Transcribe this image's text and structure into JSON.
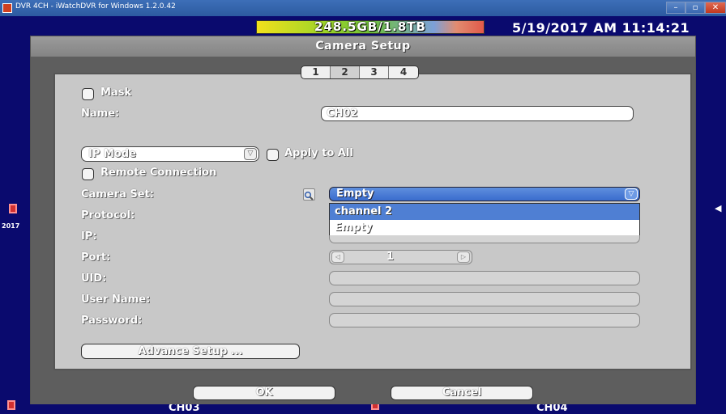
{
  "window": {
    "title": "DVR 4CH - iWatchDVR for Windows 1.2.0.42",
    "min": "–",
    "max": "▫",
    "close": "✕"
  },
  "status": {
    "storage": "248.5GB/1.8TB",
    "datetime": "5/19/2017 AM 11:14:21"
  },
  "background": {
    "cam_labels": [
      "CH03",
      "CH04"
    ],
    "side_year": "2017",
    "arrow": "◀"
  },
  "dialog": {
    "title": "Camera Setup",
    "tabs": [
      "1",
      "2",
      "3",
      "4"
    ],
    "active_tab": "2",
    "mask_label": "Mask",
    "name_label": "Name:",
    "name_value": "CH02",
    "mode_value": "IP Mode",
    "mode_arrow": "▽",
    "apply_all_label": "Apply to All",
    "remote_label": "Remote Connection",
    "camera_set_label": "Camera Set:",
    "camera_set_value": "Empty",
    "camera_set_arrow": "▽",
    "camera_set_options": [
      "channel 2",
      "Empty"
    ],
    "protocol_label": "Protocol:",
    "ip_label": "IP:",
    "port_label": "Port:",
    "port_value": "1",
    "port_dec": "◁",
    "port_inc": "▷",
    "uid_label": "UID:",
    "username_label": "User Name:",
    "password_label": "Password:",
    "advance_button": "Advance Setup ...",
    "ok_button": "OK",
    "cancel_button": "Cancel"
  }
}
